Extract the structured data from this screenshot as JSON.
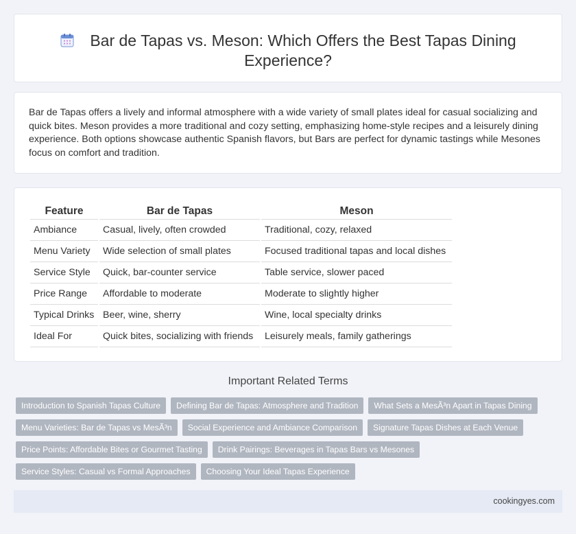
{
  "header": {
    "icon": "calendar-icon",
    "title": "Bar de Tapas vs. Meson: Which Offers the Best Tapas Dining Experience?"
  },
  "intro": {
    "text": "Bar de Tapas offers a lively and informal atmosphere with a wide variety of small plates ideal for casual socializing and quick bites. Meson provides a more traditional and cozy setting, emphasizing home-style recipes and a leisurely dining experience. Both options showcase authentic Spanish flavors, but Bars are perfect for dynamic tastings while Mesones focus on comfort and tradition."
  },
  "table": {
    "headers": [
      "Feature",
      "Bar de Tapas",
      "Meson"
    ],
    "rows": [
      [
        "Ambiance",
        "Casual, lively, often crowded",
        "Traditional, cozy, relaxed"
      ],
      [
        "Menu Variety",
        "Wide selection of small plates",
        "Focused traditional tapas and local dishes"
      ],
      [
        "Service Style",
        "Quick, bar-counter service",
        "Table service, slower paced"
      ],
      [
        "Price Range",
        "Affordable to moderate",
        "Moderate to slightly higher"
      ],
      [
        "Typical Drinks",
        "Beer, wine, sherry",
        "Wine, local specialty drinks"
      ],
      [
        "Ideal For",
        "Quick bites, socializing with friends",
        "Leisurely meals, family gatherings"
      ]
    ]
  },
  "related": {
    "title": "Important Related Terms",
    "rows": [
      [
        "Introduction to Spanish Tapas Culture",
        "Defining Bar de Tapas: Atmosphere and Tradition",
        "What Sets a MesÃ³n Apart in Tapas Dining"
      ],
      [
        "Menu Varieties: Bar de Tapas vs MesÃ³n",
        "Social Experience and Ambiance Comparison",
        "Signature Tapas Dishes at Each Venue"
      ],
      [
        "Price Points: Affordable Bites or Gourmet Tasting",
        "Drink Pairings: Beverages in Tapas Bars vs Mesones"
      ],
      [
        "Service Styles: Casual vs Formal Approaches",
        "Choosing Your Ideal Tapas Experience"
      ]
    ]
  },
  "footer": {
    "site": "cookingyes.com"
  },
  "colors": {
    "background": "#f1f3f8",
    "tag": "#b0b6c0",
    "footer": "#e5eaf4",
    "icon_accent": "#6b8fd6"
  }
}
